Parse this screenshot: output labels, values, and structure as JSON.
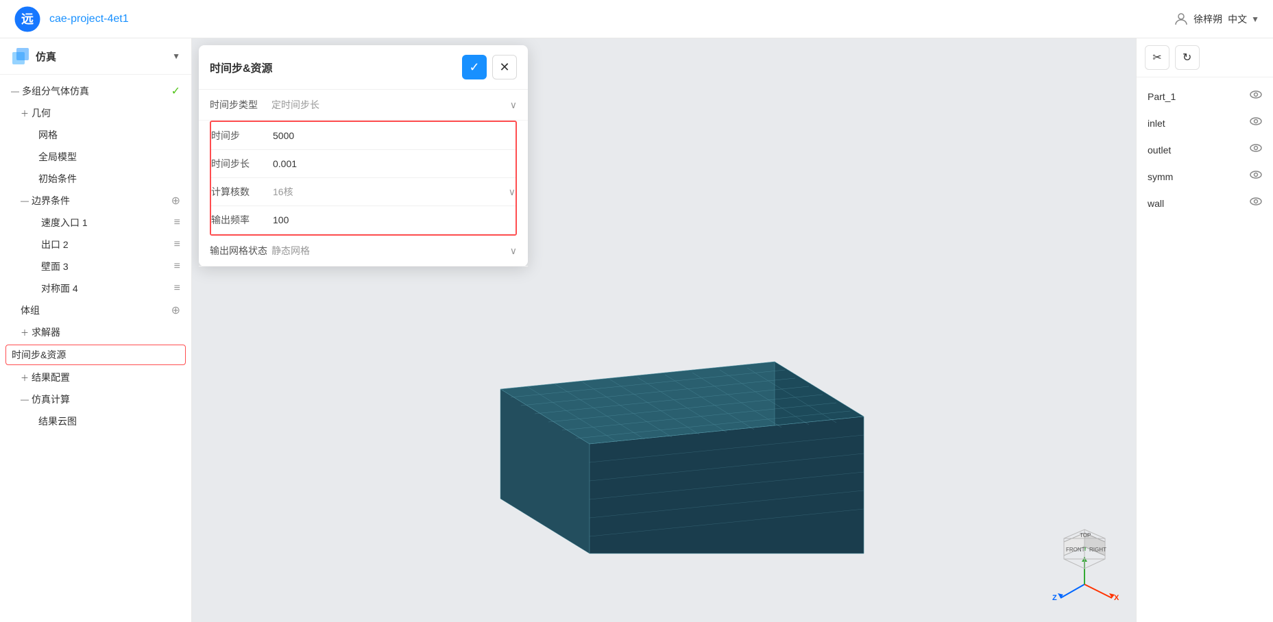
{
  "header": {
    "project_name": "cae-project-4et1",
    "user_name": "徐梓朔",
    "language": "中文"
  },
  "sidebar": {
    "title": "仿真",
    "tree": [
      {
        "id": "multigas",
        "label": "多组分气体仿真",
        "indent": 0,
        "expand": "minus",
        "status": "green"
      },
      {
        "id": "geometry",
        "label": "几何",
        "indent": 1,
        "expand": "plus"
      },
      {
        "id": "mesh",
        "label": "网格",
        "indent": 2
      },
      {
        "id": "global_model",
        "label": "全局模型",
        "indent": 2
      },
      {
        "id": "init_cond",
        "label": "初始条件",
        "indent": 2
      },
      {
        "id": "boundary",
        "label": "边界条件",
        "indent": 1,
        "expand": "minus",
        "action": "plus"
      },
      {
        "id": "vel_inlet",
        "label": "速度入口 1",
        "indent": 3,
        "action": "menu"
      },
      {
        "id": "outlet",
        "label": "出口 2",
        "indent": 3,
        "action": "menu"
      },
      {
        "id": "wall",
        "label": "壁面 3",
        "indent": 3,
        "action": "menu"
      },
      {
        "id": "symm",
        "label": "对称面 4",
        "indent": 3,
        "action": "menu"
      },
      {
        "id": "body_group",
        "label": "体组",
        "indent": 1,
        "action": "plus"
      },
      {
        "id": "solver",
        "label": "求解器",
        "indent": 1,
        "expand": "plus"
      },
      {
        "id": "time_resource",
        "label": "时间步&资源",
        "indent": 2,
        "active": true
      },
      {
        "id": "result_config",
        "label": "结果配置",
        "indent": 1,
        "expand": "plus"
      },
      {
        "id": "sim_calc",
        "label": "仿真计算",
        "indent": 1,
        "expand": "minus"
      },
      {
        "id": "result_cloud",
        "label": "结果云图",
        "indent": 2
      }
    ]
  },
  "dialog": {
    "title": "时间步&资源",
    "confirm_label": "✓",
    "close_label": "✕",
    "fields": [
      {
        "id": "time_step_type",
        "label": "时间步类型",
        "value": "定时间步长",
        "type": "select",
        "highlighted": false
      },
      {
        "id": "time_step",
        "label": "时间步",
        "value": "5000",
        "type": "input",
        "highlighted": true
      },
      {
        "id": "time_step_length",
        "label": "时间步长",
        "value": "0.001",
        "type": "input",
        "highlighted": true
      },
      {
        "id": "calc_cores",
        "label": "计算核数",
        "value": "16核",
        "type": "select",
        "highlighted": true
      },
      {
        "id": "output_freq",
        "label": "输出频率",
        "value": "100",
        "type": "input",
        "highlighted": true
      },
      {
        "id": "output_mesh",
        "label": "输出网格状态",
        "value": "静态网格",
        "type": "select",
        "highlighted": false
      }
    ]
  },
  "right_panel": {
    "tools": [
      {
        "id": "scissors",
        "icon": "✂",
        "label": "scissors-tool"
      },
      {
        "id": "reset",
        "icon": "↺",
        "label": "reset-tool"
      }
    ],
    "parts": [
      {
        "id": "part1",
        "label": "Part_1",
        "visible": true
      },
      {
        "id": "inlet",
        "label": "inlet",
        "visible": true
      },
      {
        "id": "outlet",
        "label": "outlet",
        "visible": true
      },
      {
        "id": "symm",
        "label": "symm",
        "visible": true
      },
      {
        "id": "wall_part",
        "label": "wall",
        "visible": true
      }
    ]
  },
  "viewport": {
    "background_color": "#e8eaed"
  }
}
